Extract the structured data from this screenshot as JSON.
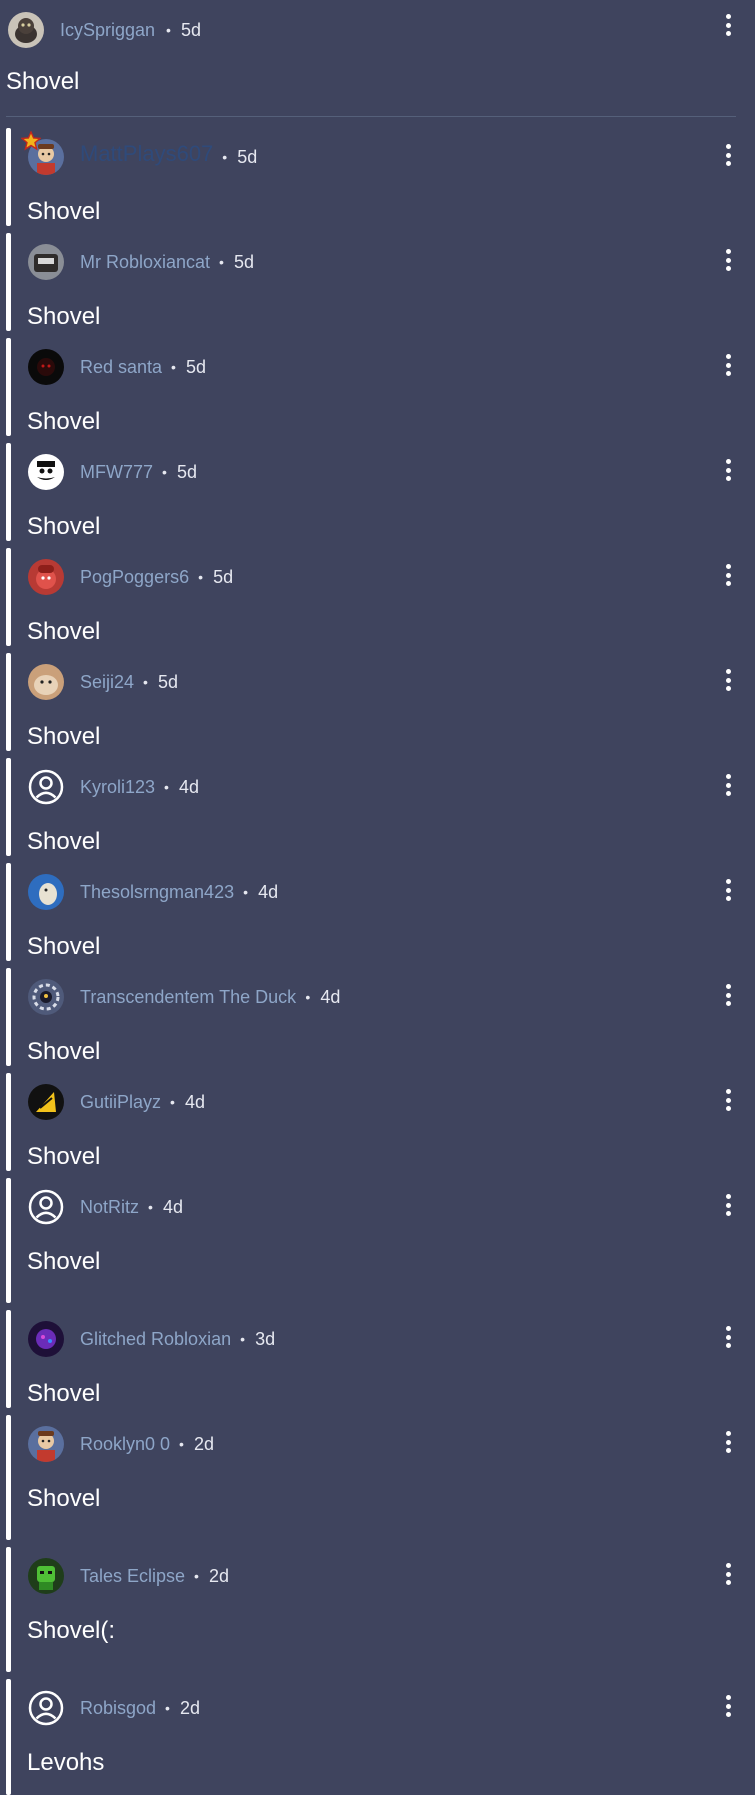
{
  "separator": "•",
  "top_comment": {
    "username": "IcySpriggan",
    "time": "5d",
    "text": "Shovel",
    "avatar": "cat-avatar"
  },
  "replies": [
    {
      "username": "MattPlays607",
      "time": "5d",
      "text": "Shovel",
      "avatar": "character-avatar",
      "badge": "star-badge-icon"
    },
    {
      "username": "Mr Robloxiancat",
      "time": "5d",
      "text": "Shovel",
      "avatar": "cat-avatar"
    },
    {
      "username": "Red santa",
      "time": "5d",
      "text": "Shovel",
      "avatar": "dark-avatar"
    },
    {
      "username": "MFW777",
      "time": "5d",
      "text": "Shovel",
      "avatar": "mustache-avatar"
    },
    {
      "username": "PogPoggers6",
      "time": "5d",
      "text": "Shovel",
      "avatar": "red-character-avatar"
    },
    {
      "username": "Seiji24",
      "time": "5d",
      "text": "Shovel",
      "avatar": "hamster-avatar"
    },
    {
      "username": "Kyroli123",
      "time": "4d",
      "text": "Shovel",
      "avatar": "default-user-icon"
    },
    {
      "username": "Thesolsrngman423",
      "time": "4d",
      "text": "Shovel",
      "avatar": "blue-dog-avatar"
    },
    {
      "username": "Transcendentem The Duck",
      "time": "4d",
      "text": "Shovel",
      "avatar": "duck-avatar"
    },
    {
      "username": "GutiiPlayz",
      "time": "4d",
      "text": "Shovel",
      "avatar": "yellow-logo-avatar"
    },
    {
      "username": "NotRitz",
      "time": "4d",
      "text": "Shovel",
      "avatar": "default-user-icon"
    },
    {
      "username": "Glitched Robloxian",
      "time": "3d",
      "text": "Shovel",
      "avatar": "purple-avatar"
    },
    {
      "username": "Rooklyn0 0",
      "time": "2d",
      "text": "Shovel",
      "avatar": "character-avatar"
    },
    {
      "username": "Tales Eclipse",
      "time": "2d",
      "text": "Shovel(:",
      "avatar": "green-robot-avatar"
    },
    {
      "username": "Robisgod",
      "time": "2d",
      "text": "Levohs",
      "avatar": "default-user-icon"
    }
  ],
  "colors": {
    "background": "#3f445e",
    "username": "#8ea6c8",
    "text": "#ffffff"
  },
  "icons": {
    "more": "vertical-ellipsis-icon"
  }
}
